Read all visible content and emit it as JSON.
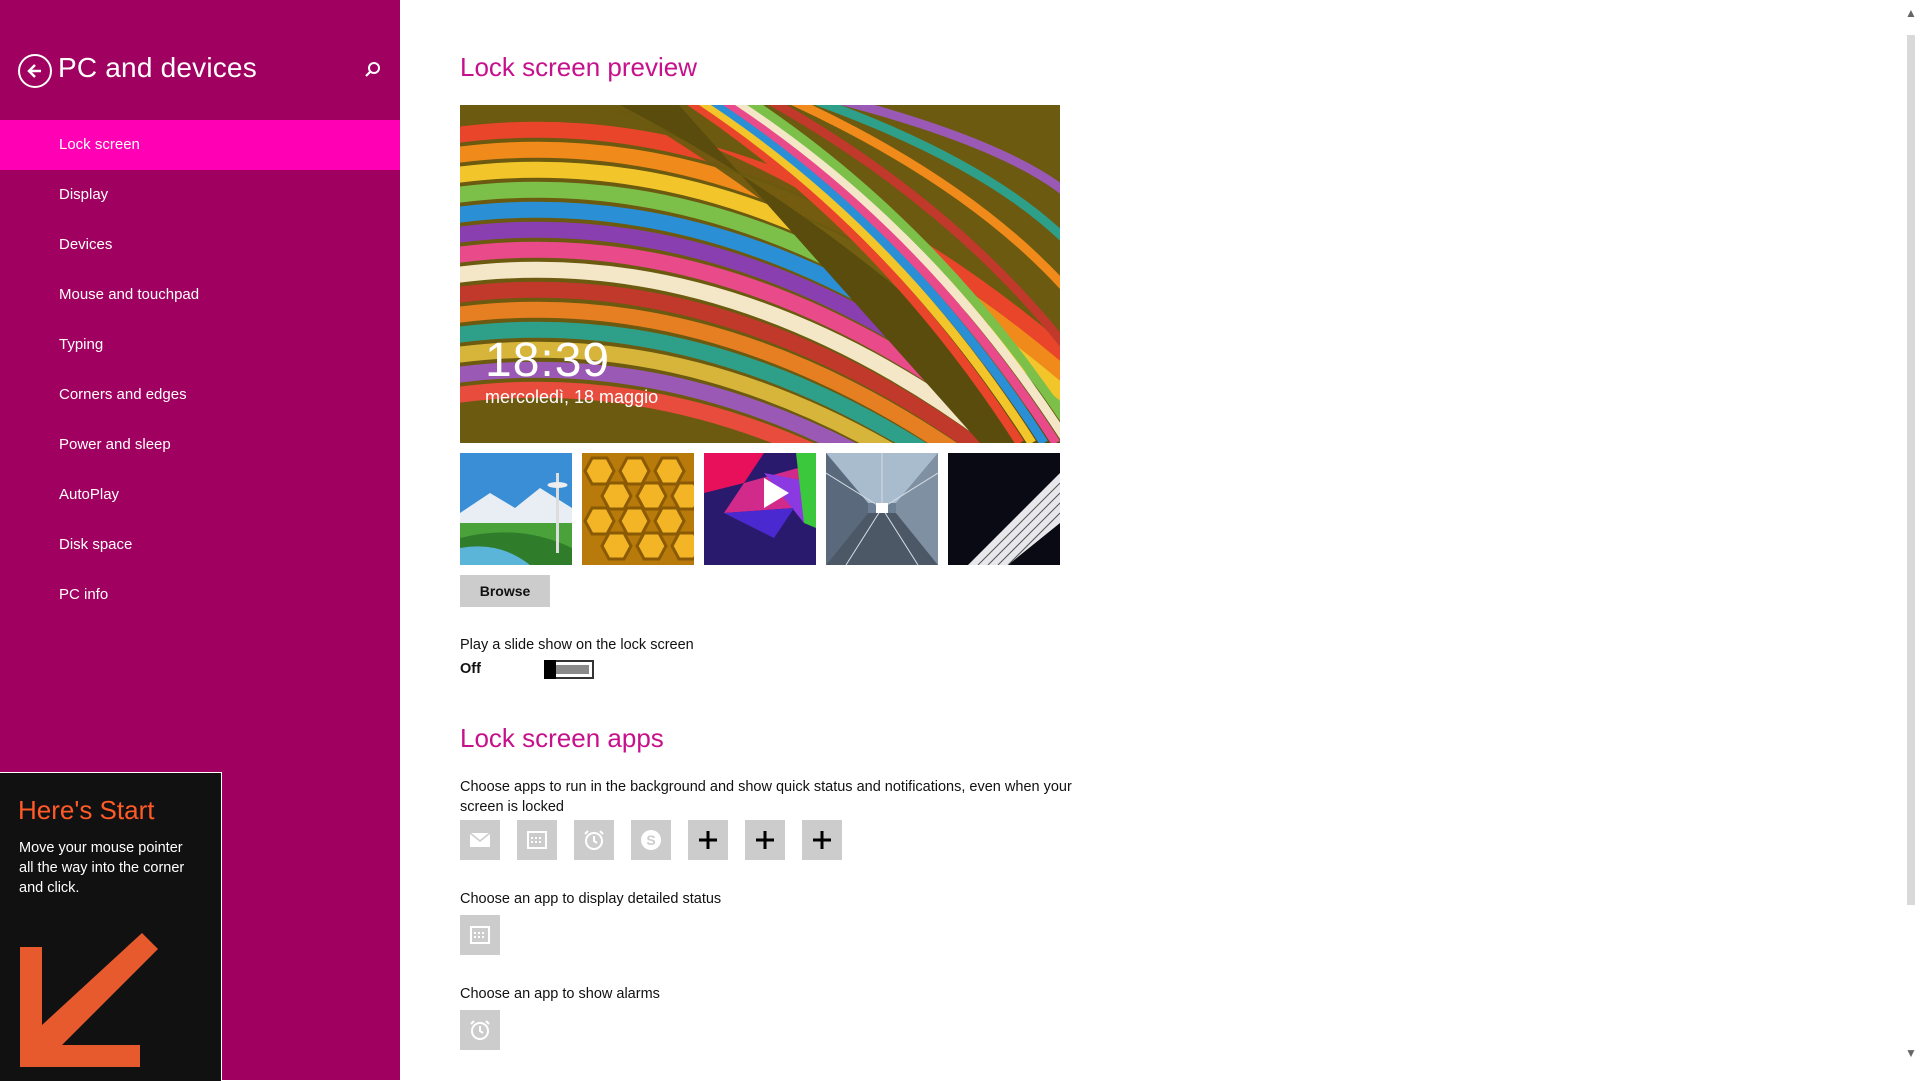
{
  "colors": {
    "sidebar_bg": "#a0005f",
    "sidebar_active": "#ff00b4",
    "section_title": "#c7118c",
    "tip_accent": "#ff5a28"
  },
  "header": {
    "back_icon": "back-arrow-icon",
    "title": "PC and devices",
    "search_icon": "search-icon"
  },
  "sidebar": {
    "items": [
      {
        "label": "Lock screen",
        "active": true
      },
      {
        "label": "Display"
      },
      {
        "label": "Devices"
      },
      {
        "label": "Mouse and touchpad"
      },
      {
        "label": "Typing"
      },
      {
        "label": "Corners and edges"
      },
      {
        "label": "Power and sleep"
      },
      {
        "label": "AutoPlay"
      },
      {
        "label": "Disk space"
      },
      {
        "label": "PC info"
      }
    ]
  },
  "tip": {
    "title": "Here's Start",
    "body": "Move your mouse pointer all the way into the corner and click."
  },
  "main": {
    "preview_title": "Lock screen preview",
    "clock": "18:39",
    "date": "mercoledì, 18 maggio",
    "thumbnails": [
      "seattle-space-needle",
      "honeycomb",
      "geometric-shapes",
      "station-platform",
      "piano-keys"
    ],
    "browse_label": "Browse",
    "slideshow_label": "Play a slide show on the lock screen",
    "slideshow_state": "Off",
    "apps_title": "Lock screen apps",
    "apps_desc": "Choose apps to run in the background and show quick status and notifications, even when your screen is locked",
    "app_slots": [
      "mail-icon",
      "calendar-icon",
      "alarm-icon",
      "skype-icon",
      "plus-icon",
      "plus-icon",
      "plus-icon"
    ],
    "detailed_status_label": "Choose an app to display detailed status",
    "detailed_status_app": "calendar-icon",
    "alarms_label": "Choose an app to show alarms",
    "alarms_app": "alarm-icon"
  }
}
